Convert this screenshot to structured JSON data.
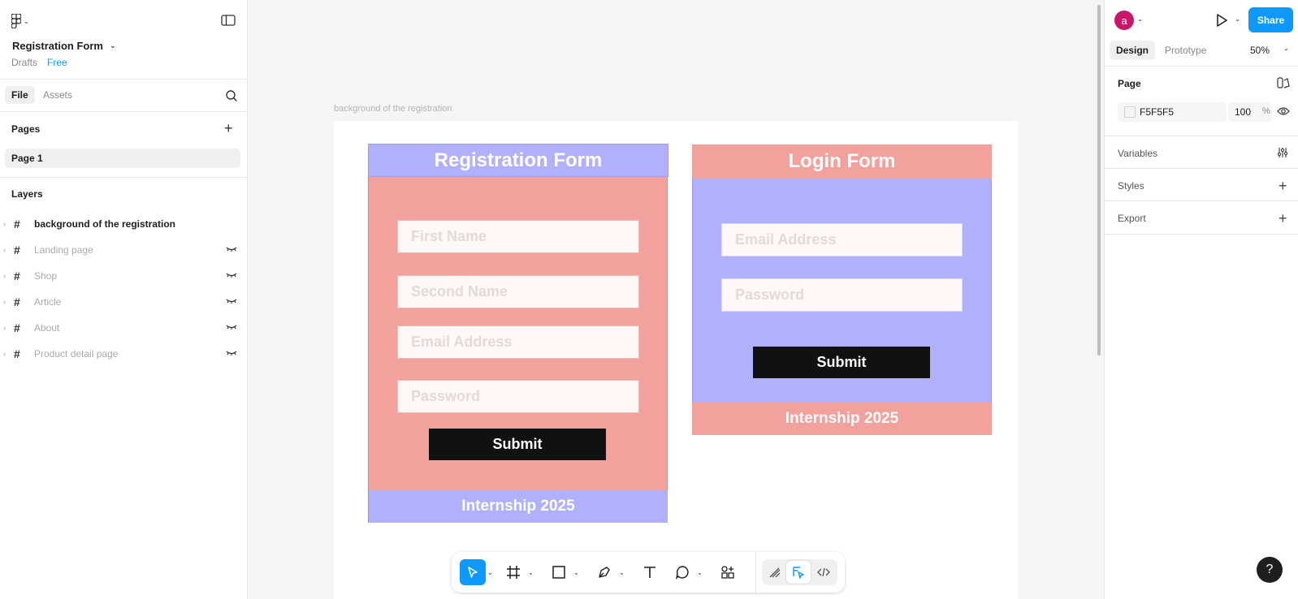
{
  "left_panel": {
    "file_title": "Registration Form",
    "drafts": "Drafts",
    "plan_badge": "Free",
    "tabs": {
      "file": "File",
      "assets": "Assets"
    },
    "pages_heading": "Pages",
    "pages": [
      "Page 1"
    ],
    "layers_heading": "Layers",
    "layers": [
      {
        "name": "background of the registration",
        "hidden": false
      },
      {
        "name": "Landing page",
        "hidden": true
      },
      {
        "name": "Shop",
        "hidden": true
      },
      {
        "name": "Article",
        "hidden": true
      },
      {
        "name": "About",
        "hidden": true
      },
      {
        "name": "Product detail page",
        "hidden": true
      }
    ]
  },
  "canvas": {
    "frame_label": "background of the registration",
    "registration": {
      "title": "Registration Form",
      "fields": [
        "First Name",
        "Second Name",
        "Email Address",
        "Password"
      ],
      "submit": "Submit",
      "footer": "Internship 2025"
    },
    "login": {
      "title": "Login Form",
      "fields": [
        "Email Address",
        "Password"
      ],
      "submit": "Submit",
      "footer": "Internship  2025"
    }
  },
  "right_panel": {
    "avatar_letter": "a",
    "share": "Share",
    "tabs": {
      "design": "Design",
      "prototype": "Prototype"
    },
    "zoom": "50%",
    "page_heading": "Page",
    "page_color": "F5F5F5",
    "page_opacity": "100",
    "opacity_unit": "%",
    "variables": "Variables",
    "styles": "Styles",
    "export": "Export",
    "help": "?"
  },
  "colors": {
    "accent": "#0d99ff",
    "salmon": "#f2a19c",
    "lavender": "#b1b0fd",
    "button_black": "#111111",
    "avatar": "#c9156b"
  },
  "toolbar": {
    "tools": [
      "move-tool",
      "frame-tool",
      "rectangle-tool",
      "pen-tool",
      "text-tool",
      "comment-tool",
      "actions-tool",
      "draw-mode",
      "design-mode",
      "dev-mode"
    ]
  }
}
